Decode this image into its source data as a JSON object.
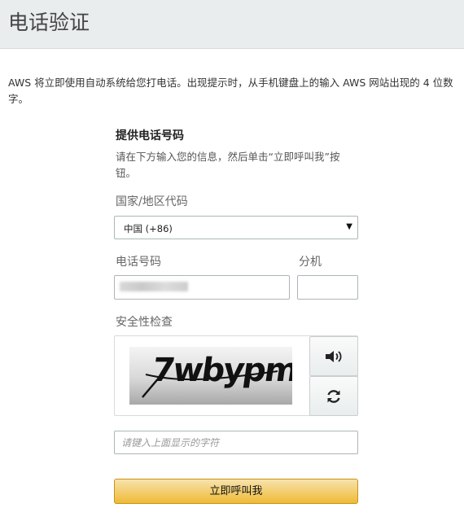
{
  "header": {
    "title": "电话验证"
  },
  "intro": {
    "text": "AWS 将立即使用自动系统给您打电话。出现提示时，从手机键盘上的输入 AWS 网站出现的 4 位数字。"
  },
  "form": {
    "section_title": "提供电话号码",
    "section_desc": "请在下方输入您的信息，然后单击“立即呼叫我”按钮。",
    "country_label": "国家/地区代码",
    "country_value": "中国 (+86)",
    "phone_label": "电话号码",
    "extension_label": "分机",
    "security_label": "安全性检查",
    "captcha_text": "7wbypm",
    "captcha_placeholder": "请键入上面显示的字符",
    "submit_label": "立即呼叫我"
  },
  "icons": {
    "audio": "speaker-icon",
    "refresh": "refresh-icon",
    "dropdown": "caret-down-icon"
  },
  "colors": {
    "header_bg": "#eaeded",
    "button_top": "#f8e3ad",
    "button_bottom": "#eeba37",
    "button_border": "#c89411"
  }
}
